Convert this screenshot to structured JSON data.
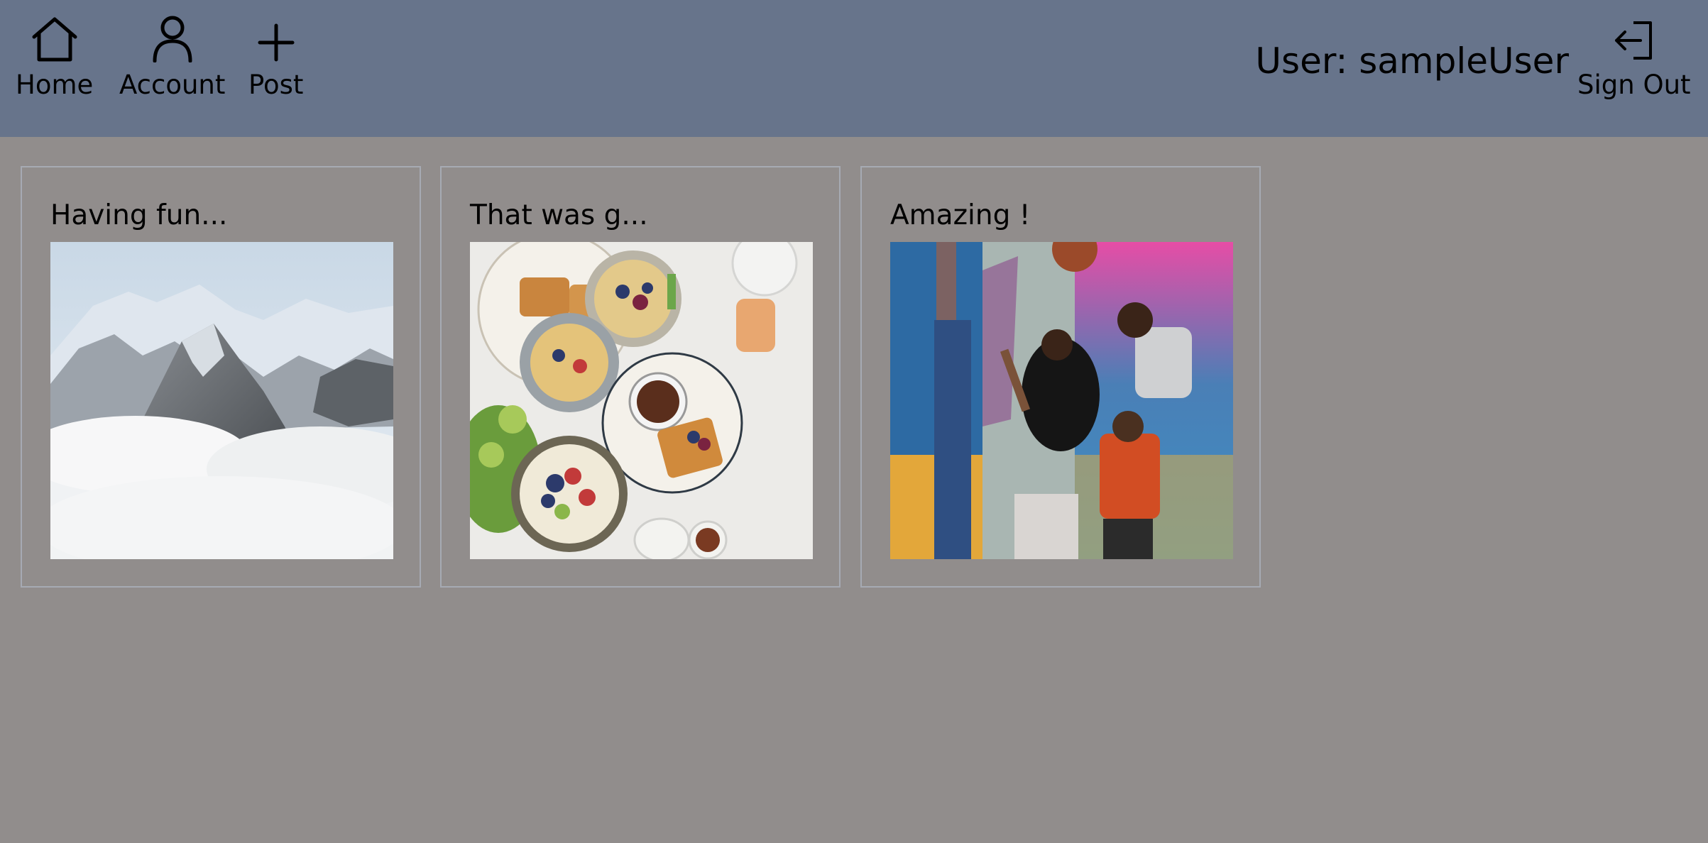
{
  "nav": {
    "home": {
      "label": "Home",
      "icon": "home-icon"
    },
    "account": {
      "label": "Account",
      "icon": "user-icon"
    },
    "post": {
      "label": "Post",
      "icon": "plus-icon"
    }
  },
  "user": {
    "label": "User: sampleUser"
  },
  "signout": {
    "label": "Sign Out",
    "icon": "sign-out-icon"
  },
  "posts": [
    {
      "title": "Having fun...",
      "image": "mountain-photo"
    },
    {
      "title": "That was g...",
      "image": "breakfast-photo"
    },
    {
      "title": "Amazing !",
      "image": "basketball-photo"
    }
  ],
  "colors": {
    "topbar": "#67748b",
    "background": "#918d8c",
    "card_border": "#a6aab3"
  }
}
